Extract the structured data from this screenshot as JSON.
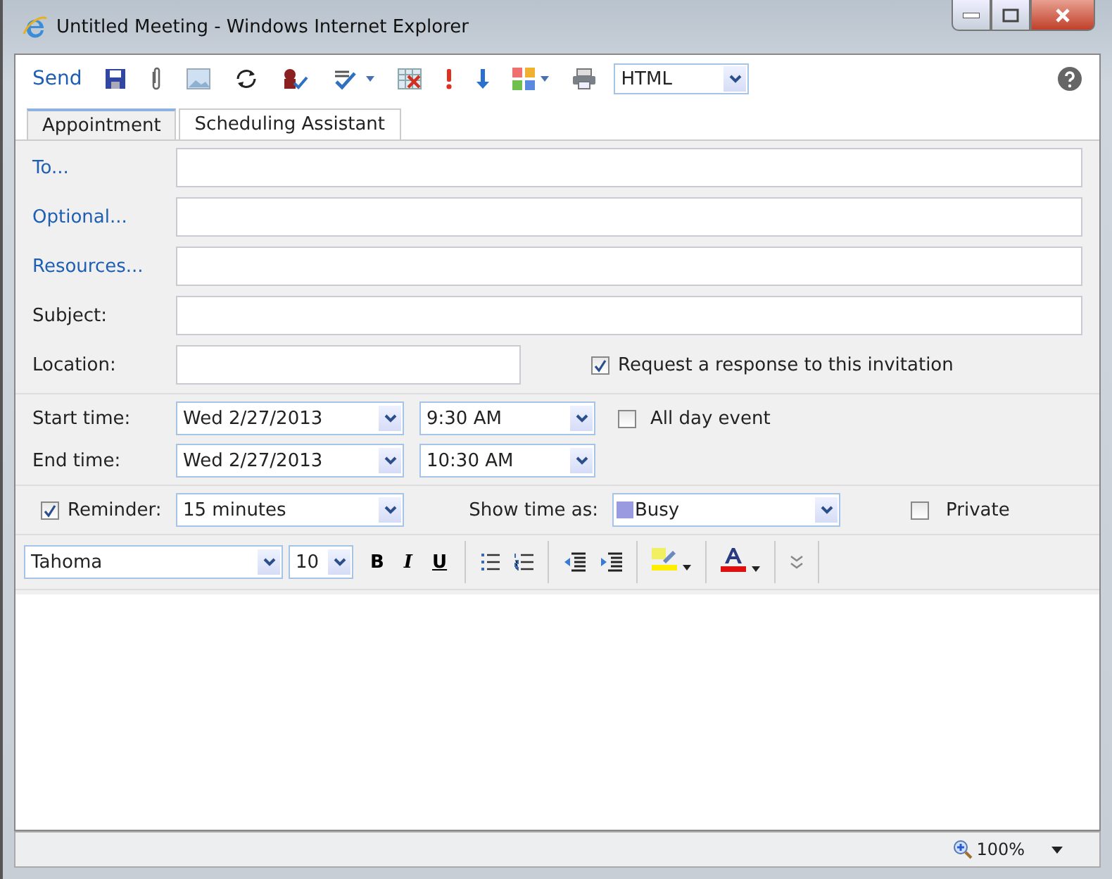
{
  "window": {
    "title": "Untitled Meeting - Windows Internet Explorer"
  },
  "toolbar": {
    "send": "Send",
    "format": "HTML"
  },
  "tabs": [
    {
      "label": "Appointment",
      "selected": true
    },
    {
      "label": "Scheduling Assistant",
      "selected": false
    }
  ],
  "address_fields": [
    {
      "label": "To...",
      "kind": "link"
    },
    {
      "label": "Optional...",
      "kind": "link"
    },
    {
      "label": "Resources...",
      "kind": "link"
    },
    {
      "label": "Subject:",
      "kind": "plain"
    }
  ],
  "location": {
    "label": "Location:"
  },
  "request_response": {
    "label": "Request a response to this invitation",
    "checked": true
  },
  "times": [
    {
      "label": "Start time:",
      "date": "Wed 2/27/2013",
      "time": "9:30 AM"
    },
    {
      "label": "End time:",
      "date": "Wed 2/27/2013",
      "time": "10:30 AM"
    }
  ],
  "all_day": {
    "label": "All day event",
    "checked": false
  },
  "reminder": {
    "label": "Reminder:",
    "checked": true,
    "value": "15 minutes"
  },
  "show_time_as": {
    "label": "Show time as:",
    "value": "Busy",
    "color": "#9a9ae0"
  },
  "private": {
    "label": "Private",
    "checked": false
  },
  "format_bar": {
    "font": "Tahoma",
    "size": "10",
    "bold": "B",
    "italic": "I",
    "underline": "U"
  },
  "status_bar": {
    "zoom": "100%"
  }
}
